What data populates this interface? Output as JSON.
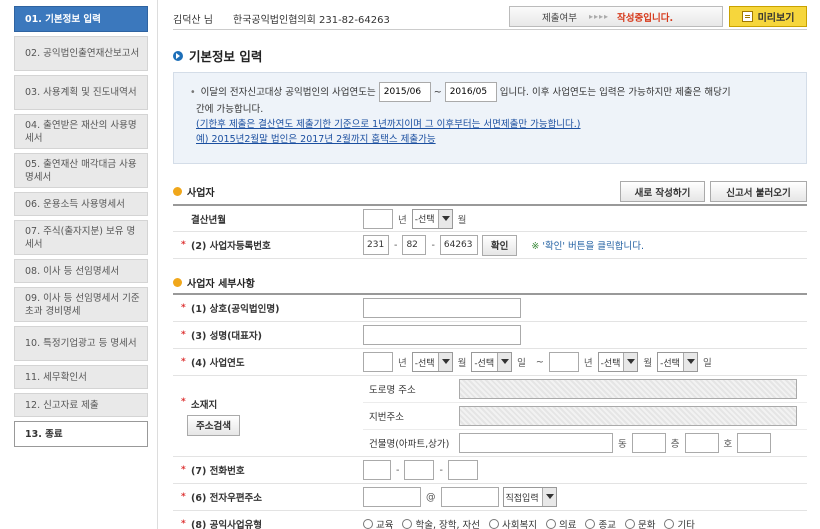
{
  "sidebar": {
    "items": [
      {
        "label": "01. 기본정보 입력"
      },
      {
        "label": "02. 공익법인출연재산보고서"
      },
      {
        "label": "03. 사용계획 및 진도내역서"
      },
      {
        "label": "04. 출연받은 재산의 사용명세서"
      },
      {
        "label": "05. 출연재산 매각대금 사용명세서"
      },
      {
        "label": "06. 운용소득 사용명세서"
      },
      {
        "label": "07. 주식(출자지분) 보유 명세서"
      },
      {
        "label": "08. 이사 등 선임명세서"
      },
      {
        "label": "09. 이사 등 선임명세서 기준초과 경비명세"
      },
      {
        "label": "10. 특정기업광고 등 명세서"
      },
      {
        "label": "11. 세무확인서"
      },
      {
        "label": "12. 신고자료 제출"
      },
      {
        "label": "13. 종료"
      }
    ]
  },
  "header": {
    "user": "김덕산 님",
    "org": "한국공익법인협의회 231-82-64263",
    "status_label": "제출여부",
    "status_arrows": "▸▸▸▸",
    "status_value": "작성중입니다.",
    "preview": "미리보기"
  },
  "page_title": "기본정보 입력",
  "notice": {
    "text1": "이달의 전자신고대상 공익법인의 사업연도는",
    "from": "2015/06",
    "tilde": "~",
    "to": "2016/05",
    "text2": "입니다.  이후 사업연도는 입력은 가능하지만 제출은 해당기",
    "text3": "간에 가능합니다.",
    "link1": "(기한후 제출은 결산연도 제출기한 기준으로 1년까지이며 그 이후부터는 서면제출만 가능합니다.)",
    "link2": "예) 2015년2월말 법인은 2017년 2월까지 홈택스 제출가능"
  },
  "section1": {
    "title": "사업자",
    "new_btn": "새로 작성하기",
    "load_btn": "신고서 불러오기",
    "fiscal_label": "결산년월",
    "year_unit": "년",
    "select": "-선택",
    "month_unit": "월",
    "bizno_label": "(2) 사업자등록번호",
    "biz1": "231",
    "biz2": "82",
    "biz3": "64263",
    "dash": "-",
    "confirm": "확인",
    "hint_mark": "※",
    "hint": "'확인' 버튼을 클릭합니다."
  },
  "section2": {
    "title": "사업자 세부사항",
    "name_label": "(1) 상호(공익법인명)",
    "rep_label": "(3) 성명(대표자)",
    "year_label": "(4) 사업연도",
    "year_unit": "년",
    "month_unit": "월",
    "day_unit": "일",
    "tilde": "~",
    "select": "-선택",
    "addr_label": "소재지",
    "addr_btn": "주소검색",
    "road": "도로명 주소",
    "jibun": "지번주소",
    "bldg": "건물명(아파트,상가)",
    "dong": "동",
    "floor": "층",
    "ho": "호",
    "tel_label": "(7) 전화번호",
    "dash": "-",
    "email_label": "(6) 전자우편주소",
    "at": "@",
    "email_select": "직접입력",
    "type_label": "(8) 공익사업유형",
    "types": [
      "교육",
      "학술, 장학, 자선",
      "사회복지",
      "의료",
      "종교",
      "문화",
      "기타"
    ]
  }
}
